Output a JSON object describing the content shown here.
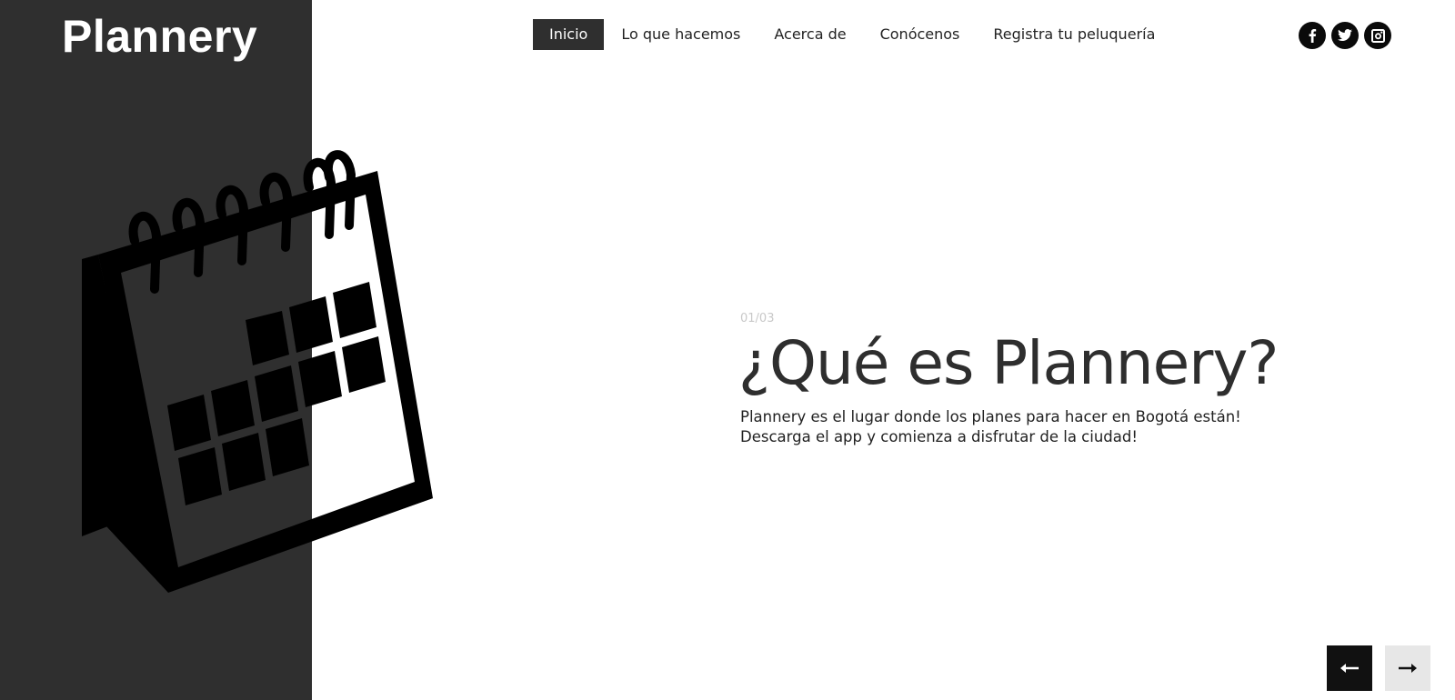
{
  "brand": {
    "name": "Plannery"
  },
  "nav": {
    "items": [
      {
        "label": "Inicio",
        "active": true
      },
      {
        "label": "Lo que hacemos",
        "active": false
      },
      {
        "label": "Acerca de",
        "active": false
      },
      {
        "label": "Conócenos",
        "active": false
      },
      {
        "label": "Registra tu peluquería",
        "active": false
      }
    ]
  },
  "social": {
    "icons": [
      "facebook-icon",
      "twitter-icon",
      "instagram-icon"
    ]
  },
  "hero": {
    "counter": "01/03",
    "title": "¿Qué es Plannery?",
    "description_lines": [
      "Plannery es el lugar donde los planes para hacer en Bogotá están!",
      "Descarga el app y comienza a disfrutar de la ciudad!"
    ]
  },
  "slider": {
    "prev_icon": "arrow-left-icon",
    "next_icon": "arrow-right-icon"
  },
  "colors": {
    "dark_panel": "#2f2f2f",
    "active_nav": "#2f2f2f",
    "counter": "#c8c8c8",
    "next_button": "#e7e7e7"
  }
}
